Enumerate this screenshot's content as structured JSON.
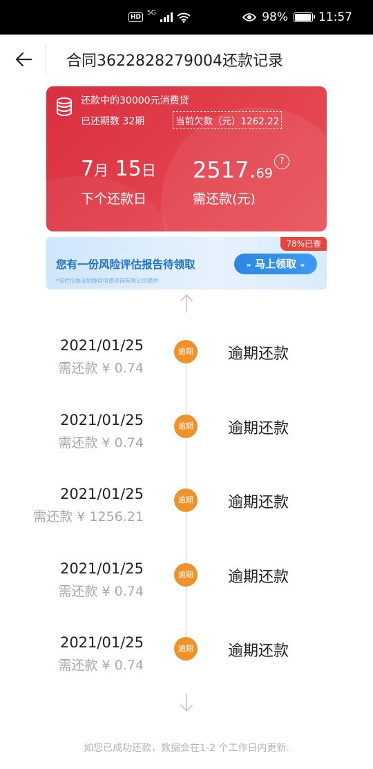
{
  "status_bar": {
    "hd": "HD",
    "network": "5G",
    "battery": "98%",
    "battery_level": 0.98,
    "time": "11:57"
  },
  "nav": {
    "title": "合同3622828279004还款记录"
  },
  "loan_card": {
    "loan_desc": "还款中的30000元消费贷",
    "paid_periods": "已还期数 32期",
    "current_owed": "当前欠款（元）1262.22",
    "next_date_month": "7",
    "next_date_month_unit": "月",
    "next_date_day": "15",
    "next_date_day_unit": "日",
    "next_date_label": "下个还款日",
    "amount_int": "2517.",
    "amount_dec": "69",
    "amount_label": "需还款(元)",
    "help": "?"
  },
  "banner": {
    "title": "您有一份风险评估报告待领取",
    "button": "马上领取",
    "tag": "78%已查",
    "note": "*该栏位由深圳捷信信德咨询有限公司提供"
  },
  "records": [
    {
      "date": "2021/01/25",
      "amount": "需还款 ¥ 0.74",
      "badge": "逾期",
      "status": "逾期还款"
    },
    {
      "date": "2021/01/25",
      "amount": "需还款 ¥ 0.74",
      "badge": "逾期",
      "status": "逾期还款"
    },
    {
      "date": "2021/01/25",
      "amount": "需还款 ¥ 1256.21",
      "badge": "逾期",
      "status": "逾期还款"
    },
    {
      "date": "2021/01/25",
      "amount": "需还款 ¥ 0.74",
      "badge": "逾期",
      "status": "逾期还款"
    },
    {
      "date": "2021/01/25",
      "amount": "需还款 ¥ 0.74",
      "badge": "逾期",
      "status": "逾期还款"
    }
  ],
  "footer_note": "如您已成功还款，数据会在1-2 个工作日内更新."
}
